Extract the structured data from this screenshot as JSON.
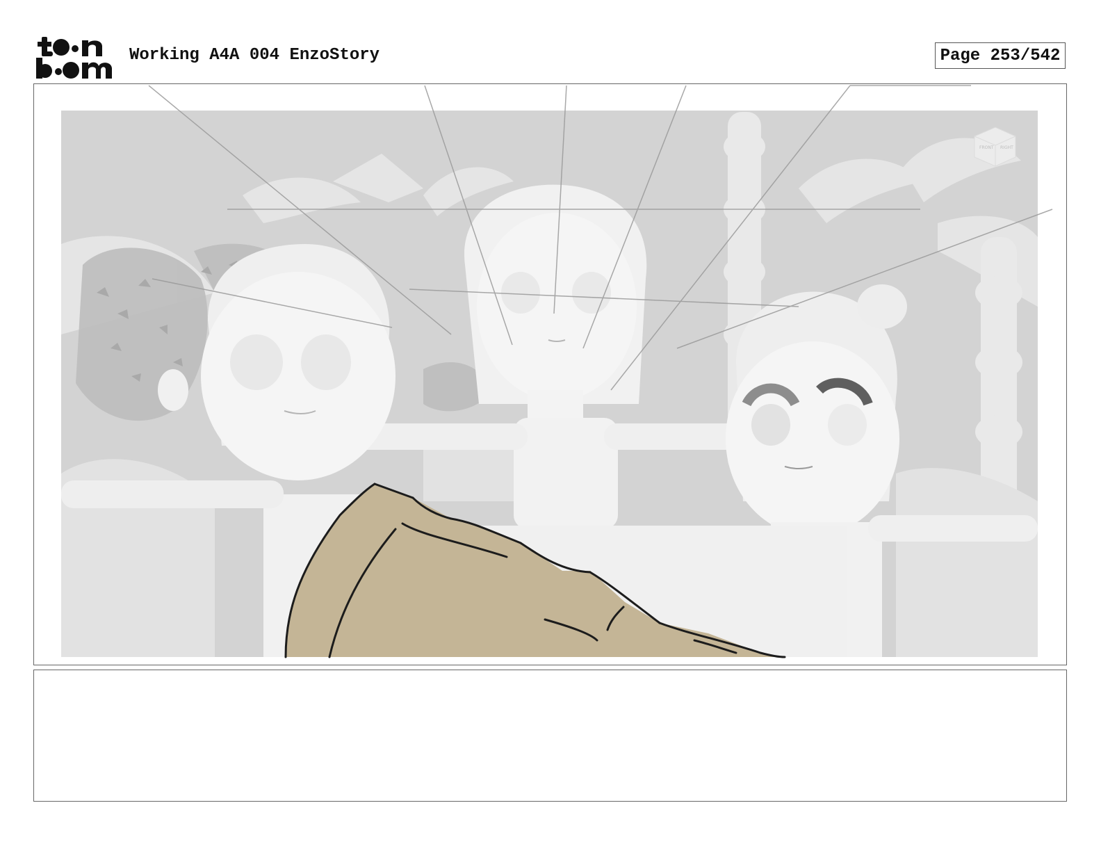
{
  "header": {
    "logo_alt": "toon boom",
    "title": "Working A4A 004 EnzoStory",
    "page_label": "Page 253/542"
  },
  "panel": {
    "viewcube_front": "FRONT",
    "viewcube_right": "RIGHT"
  },
  "notes": {
    "text": ""
  },
  "colors": {
    "sketch_fill": "#c4b596",
    "background_sky": "#d3d3d3",
    "frame_border": "#666666"
  }
}
